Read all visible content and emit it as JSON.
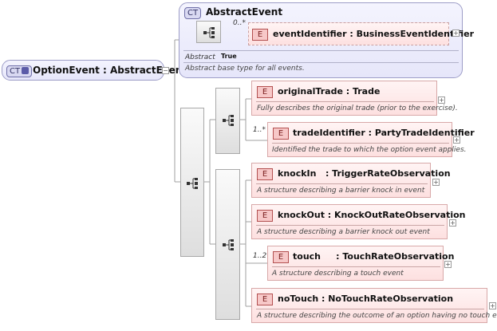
{
  "colors": {
    "complex_type_fill": "#e6e6fa",
    "element_fill": "#fde0e0",
    "element_badge": "#f7c8c8",
    "compositor_fill": "#e4e4e4",
    "connector": "#a0a0a0"
  },
  "option_event": {
    "badge": "CT",
    "title": "OptionEvent : AbstractEvent",
    "collapse_symbol": "−"
  },
  "abstract_event": {
    "badge": "CT",
    "title": "AbstractEvent",
    "attr_name": "Abstract",
    "attr_value": "True",
    "description": "Abstract base type for all events.",
    "event_identifier": {
      "badge": "E",
      "cardinality": "0..*",
      "title": "eventIdentifier : BusinessEventIdentifier",
      "expand_symbol": "+"
    }
  },
  "elements": [
    {
      "badge": "E",
      "cardinality": "",
      "title": "originalTrade : Trade",
      "description": "Fully describes the original trade (prior to the exercise).",
      "expand_symbol": "+"
    },
    {
      "badge": "E",
      "cardinality": "1..*",
      "title": "tradeIdentifier : PartyTradeIdentifier",
      "description": "Identified the trade to which the option event applies.",
      "expand_symbol": "+"
    },
    {
      "badge": "E",
      "cardinality": "",
      "title": "knockIn   : TriggerRateObservation",
      "description": "A structure describing a barrier knock in event",
      "expand_symbol": "+"
    },
    {
      "badge": "E",
      "cardinality": "",
      "title": "knockOut : KnockOutRateObservation",
      "description": "A structure describing a barrier knock out event",
      "expand_symbol": "+"
    },
    {
      "badge": "E",
      "cardinality": "1..2",
      "title": "touch     : TouchRateObservation",
      "description": "A structure describing a touch event",
      "expand_symbol": "+"
    },
    {
      "badge": "E",
      "cardinality": "",
      "title": "noTouch : NoTouchRateObservation",
      "description": "A structure describing the outcome of an option having no touch events",
      "expand_symbol": "+"
    }
  ]
}
